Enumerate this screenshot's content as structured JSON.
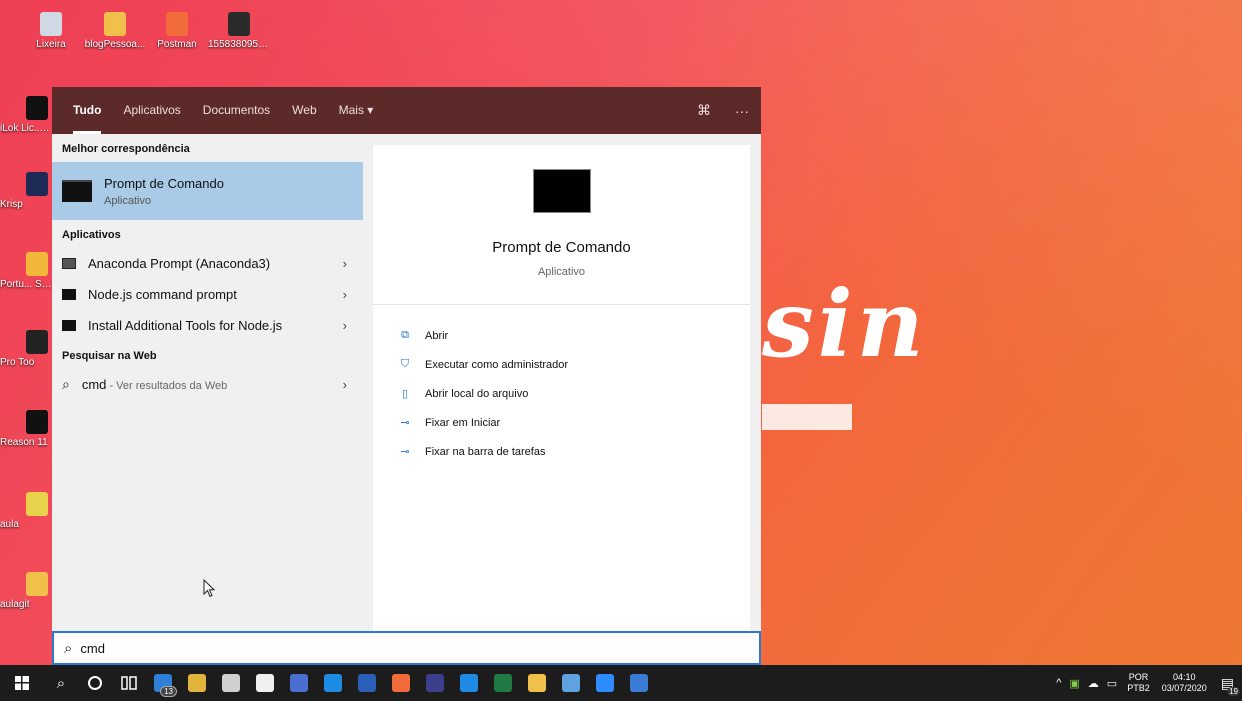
{
  "desktop": {
    "top_icons": [
      {
        "label": "Lixeira",
        "icon": "recycle-bin-icon",
        "color": "#cfd8e3"
      },
      {
        "label": "blogPessoa...",
        "icon": "folder-icon",
        "color": "#f1c04a"
      },
      {
        "label": "Postman",
        "icon": "postman-icon",
        "color": "#f26b3a"
      },
      {
        "label": "1558380959...",
        "icon": "image-file-icon",
        "color": "#2b2b2b"
      }
    ],
    "left_icons": [
      {
        "label": "iLok Lic... Manag",
        "icon": "ilok-icon",
        "color": "#111111"
      },
      {
        "label": "Krisp",
        "icon": "krisp-icon",
        "color": "#1e2b57"
      },
      {
        "label": "Portu... Studi",
        "icon": "bulb-icon",
        "color": "#f2b73a"
      },
      {
        "label": "Pro Too",
        "icon": "pro-tools-icon",
        "color": "#222222"
      },
      {
        "label": "Reason 11",
        "icon": "reason-icon",
        "color": "#111111"
      },
      {
        "label": "aula",
        "icon": "file-icon",
        "color": "#e8d24c"
      },
      {
        "label": "aulagit",
        "icon": "folder-icon",
        "color": "#f1c04a"
      }
    ]
  },
  "search_panel": {
    "tabs": [
      {
        "label": "Tudo",
        "active": true
      },
      {
        "label": "Aplicativos",
        "active": false
      },
      {
        "label": "Documentos",
        "active": false
      },
      {
        "label": "Web",
        "active": false
      },
      {
        "label": "Mais ▾",
        "active": false
      }
    ],
    "feedback_glyph": "⌘",
    "more_glyph": "···",
    "best_match_header": "Melhor correspondência",
    "best_match": {
      "title": "Prompt de Comando",
      "subtitle": "Aplicativo"
    },
    "apps_header": "Aplicativos",
    "apps": [
      {
        "label": "Anaconda Prompt (Anaconda3)"
      },
      {
        "label": "Node.js command prompt"
      },
      {
        "label": "Install Additional Tools for Node.js"
      }
    ],
    "web_header": "Pesquisar na Web",
    "web_result": {
      "query": "cmd",
      "suffix": " - Ver resultados da Web"
    },
    "chevron": "›",
    "preview": {
      "title": "Prompt de Comando",
      "subtitle": "Aplicativo",
      "actions": [
        {
          "label": "Abrir",
          "icon": "open-icon",
          "glyph": "⧉"
        },
        {
          "label": "Executar como administrador",
          "icon": "shield-run-icon",
          "glyph": "⛉"
        },
        {
          "label": "Abrir local do arquivo",
          "icon": "file-location-icon",
          "glyph": "▯"
        },
        {
          "label": "Fixar em Iniciar",
          "icon": "pin-icon",
          "glyph": "⊸"
        },
        {
          "label": "Fixar na barra de tarefas",
          "icon": "pin-taskbar-icon",
          "glyph": "⊸"
        }
      ]
    }
  },
  "searchbox": {
    "value": "cmd",
    "glyph": "⌕"
  },
  "taskbar": {
    "apps": [
      {
        "icon": "mail-icon",
        "color": "#2f7fd6",
        "badge": "13"
      },
      {
        "icon": "chrome-icon",
        "color": "#e0b33a"
      },
      {
        "icon": "box-icon",
        "color": "#d0d0d0"
      },
      {
        "icon": "store-icon",
        "color": "#f0f0f0"
      },
      {
        "icon": "remote-icon",
        "color": "#4a6fd0"
      },
      {
        "icon": "skype-icon",
        "color": "#1e8ce4"
      },
      {
        "icon": "word-icon",
        "color": "#2b5fb8"
      },
      {
        "icon": "postman-icon",
        "color": "#f26b3a"
      },
      {
        "icon": "eclipse-icon",
        "color": "#3b3f8c"
      },
      {
        "icon": "vscode-icon",
        "color": "#1e8ce4"
      },
      {
        "icon": "excel-icon",
        "color": "#1f7a44"
      },
      {
        "icon": "file-explorer-icon",
        "color": "#f1c04a"
      },
      {
        "icon": "paint-icon",
        "color": "#5ea3e0"
      },
      {
        "icon": "zoom-icon",
        "color": "#2d8cff"
      },
      {
        "icon": "window-app-icon",
        "color": "#3a7bd5"
      }
    ],
    "tray": {
      "language": "POR",
      "layout": "PTB2",
      "time": "04:10",
      "date": "03/07/2020",
      "notifications": "19"
    }
  }
}
